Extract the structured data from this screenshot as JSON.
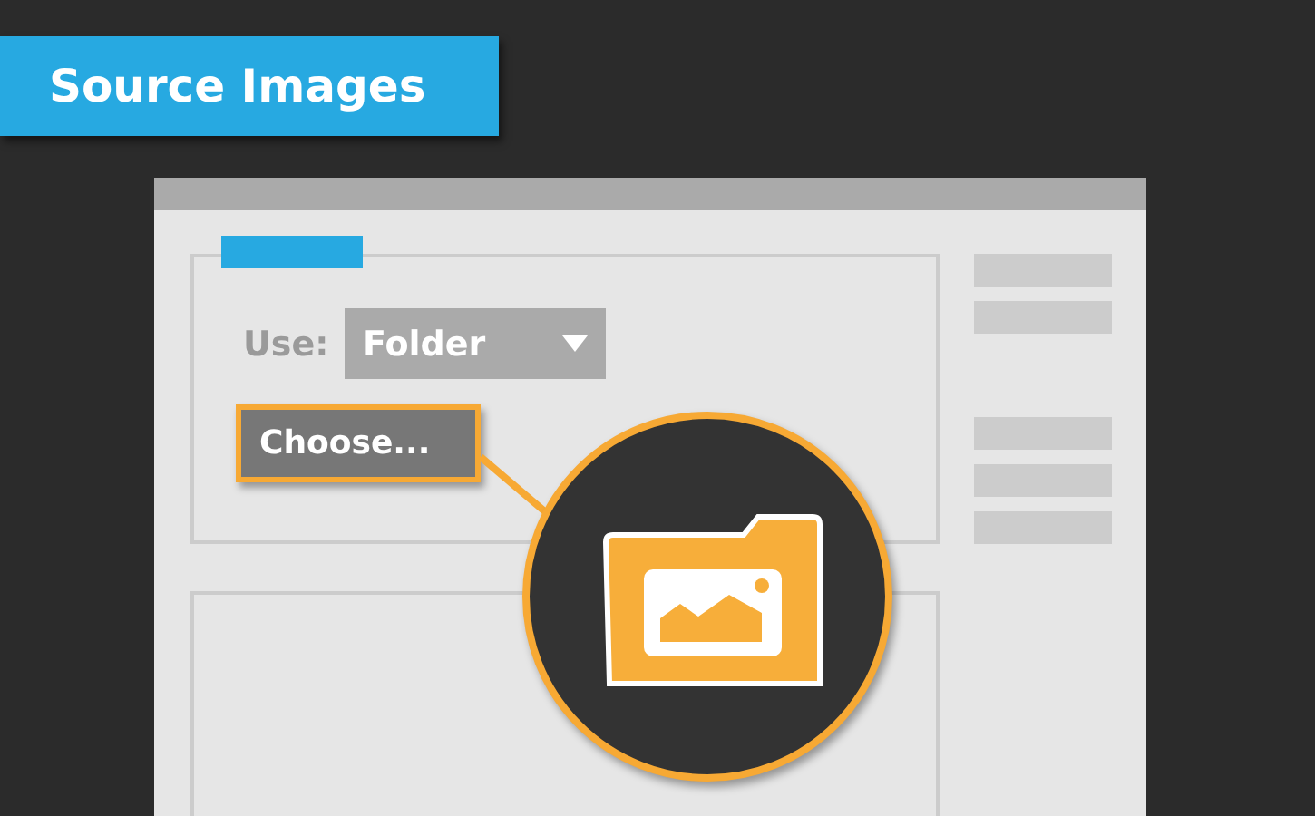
{
  "banner": {
    "title": "Source Images"
  },
  "dialog": {
    "use_label": "Use:",
    "dropdown": {
      "value": "Folder"
    },
    "choose_button": {
      "label": "Choose...",
      "highlighted": true
    }
  }
}
